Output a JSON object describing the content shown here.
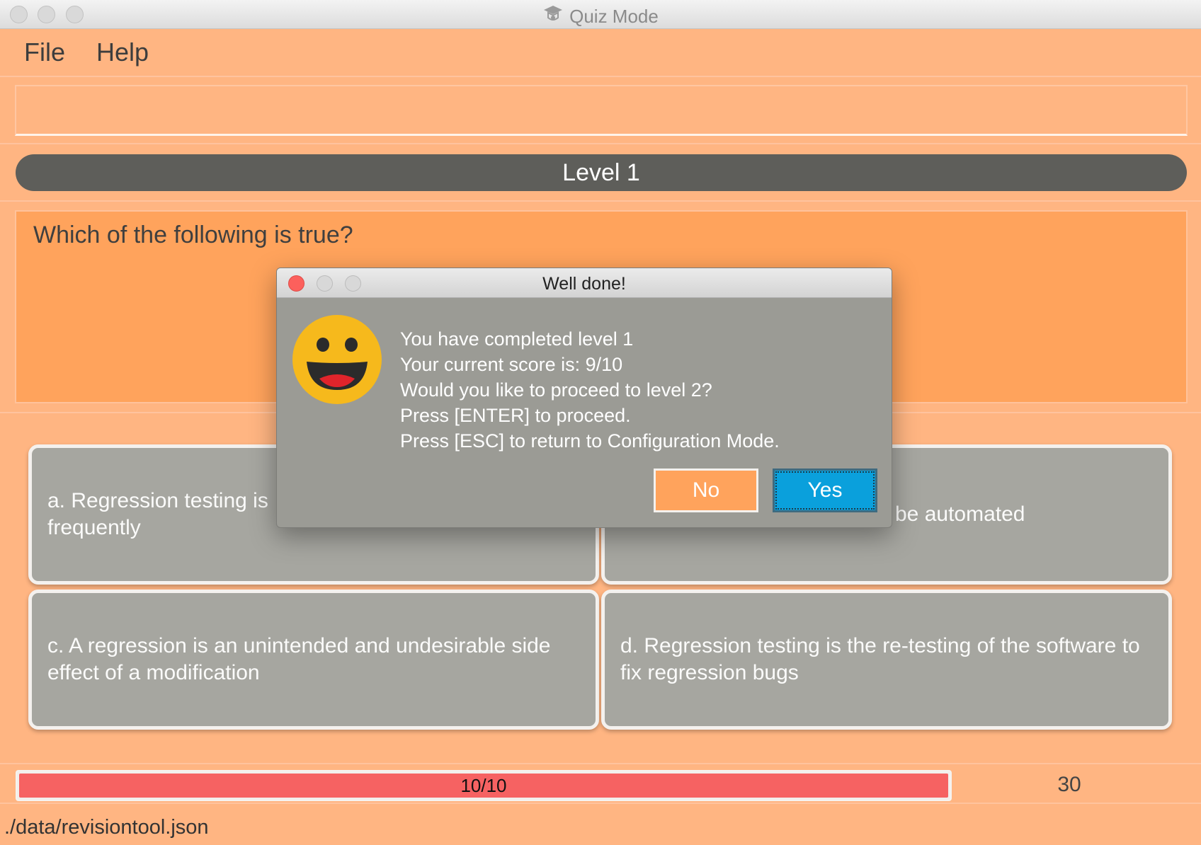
{
  "window": {
    "title": "Quiz Mode",
    "app_icon": "graduation-cap-icon"
  },
  "menu": {
    "items": [
      "File",
      "Help"
    ]
  },
  "command_box": {
    "value": ""
  },
  "level": {
    "label": "Level 1"
  },
  "question": {
    "text": "Which of the following is true?"
  },
  "options": [
    {
      "label": "a. Regression testing is",
      "label_line2": "frequently"
    },
    {
      "label": "be automated"
    },
    {
      "label": "c. A regression is an unintended and undesirable side effect of a modification"
    },
    {
      "label": "d. Regression testing is the re-testing of the software to fix regression bugs"
    }
  ],
  "progress": {
    "label": "10/10",
    "fraction": 1.0,
    "fill_color": "#f66262"
  },
  "timer": {
    "value": "30"
  },
  "status_bar": {
    "path": "./data/revisiontool.json"
  },
  "dialog": {
    "title": "Well done!",
    "icon": "smiley-face-icon",
    "lines": [
      "You have completed level 1",
      "Your current score is: 9/10",
      "Would you like to proceed to level 2?",
      "Press [ENTER] to proceed.",
      "Press [ESC] to return to Configuration Mode."
    ],
    "no_label": "No",
    "yes_label": "Yes"
  },
  "colors": {
    "background": "#ffb582",
    "question_panel": "#ffa35c",
    "level_bar": "#5e5e5a",
    "yes_button": "#0aa0dc",
    "no_button": "#ffa35c"
  }
}
